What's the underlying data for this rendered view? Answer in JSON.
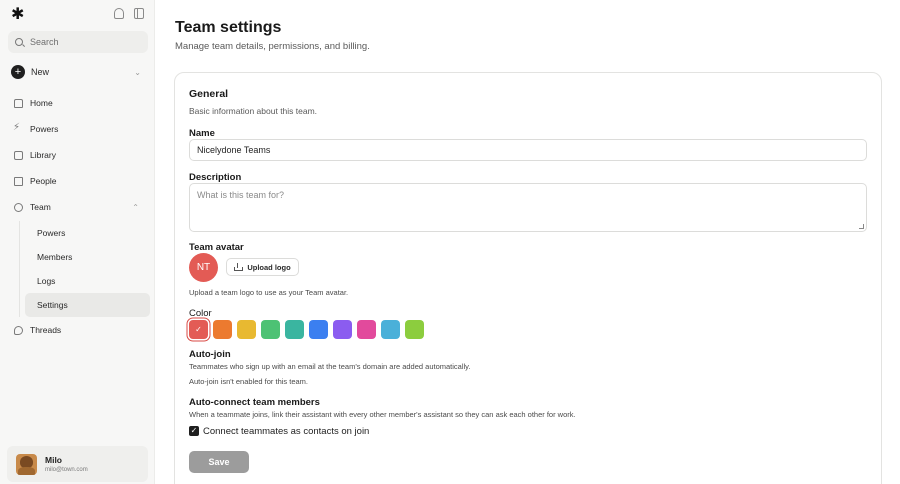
{
  "sidebar": {
    "logo_glyph": "✱",
    "search_placeholder": "Search",
    "new_label": "New",
    "items": [
      {
        "label": "Home"
      },
      {
        "label": "Powers"
      },
      {
        "label": "Library"
      },
      {
        "label": "People"
      },
      {
        "label": "Team"
      }
    ],
    "team_subitems": [
      {
        "label": "Powers"
      },
      {
        "label": "Members"
      },
      {
        "label": "Logs"
      },
      {
        "label": "Settings"
      }
    ],
    "threads_label": "Threads",
    "user": {
      "name": "Milo",
      "email": "milo@town.com"
    }
  },
  "header": {
    "title": "Team settings",
    "subtitle": "Manage team details, permissions, and billing."
  },
  "general": {
    "title": "General",
    "subtitle": "Basic information about this team.",
    "name_label": "Name",
    "name_value": "Nicelydone Teams",
    "description_label": "Description",
    "description_placeholder": "What is this team for?",
    "avatar_label": "Team avatar",
    "avatar_initials": "NT",
    "upload_label": "Upload logo",
    "upload_hint": "Upload a team logo to use as your Team avatar.",
    "color_label": "Color",
    "colors": [
      "#e35b55",
      "#ec7a2f",
      "#e8b931",
      "#4dc274",
      "#3ab5a0",
      "#3b7ff0",
      "#8b5cf0",
      "#e24a9c",
      "#4ab0d9",
      "#8ccd3e"
    ],
    "selected_color_index": 0,
    "check_glyph": "✓"
  },
  "autojoin": {
    "title": "Auto-join",
    "desc": "Teammates who sign up with an email at the team's domain are added automatically.",
    "status": "Auto-join isn't enabled for this team."
  },
  "autoconnect": {
    "title": "Auto-connect team members",
    "desc": "When a teammate joins, link their assistant with every other member's assistant so they can ask each other for work.",
    "checkbox_label": "Connect teammates as contacts on join",
    "checked": true
  },
  "save_label": "Save"
}
